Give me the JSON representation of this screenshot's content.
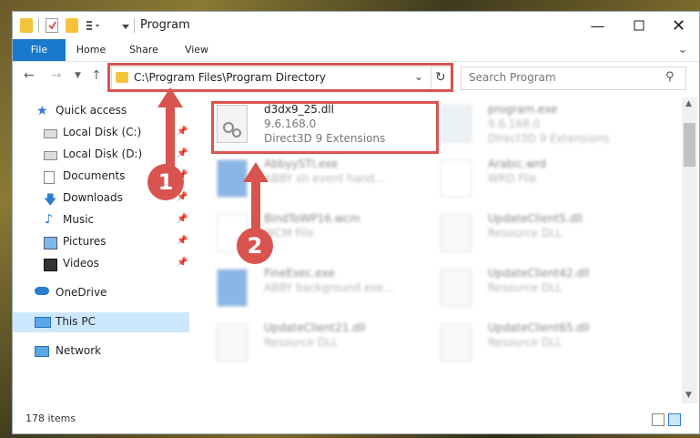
{
  "window": {
    "title": "Program"
  },
  "ribbon": {
    "tabs": [
      "File",
      "Home",
      "Share",
      "View"
    ]
  },
  "address": {
    "path": "C:\\Program Files\\Program Directory"
  },
  "search": {
    "placeholder": "Search Program"
  },
  "sidebar": {
    "items": [
      {
        "label": "Quick access",
        "icon": "star-icon",
        "pinned": false
      },
      {
        "label": "Local Disk (C:)",
        "icon": "drive-icon",
        "pinned": true
      },
      {
        "label": "Local Disk (D:)",
        "icon": "drive-icon",
        "pinned": true
      },
      {
        "label": "Documents",
        "icon": "documents-icon",
        "pinned": true
      },
      {
        "label": "Downloads",
        "icon": "download-icon",
        "pinned": true
      },
      {
        "label": "Music",
        "icon": "music-icon",
        "pinned": true
      },
      {
        "label": "Pictures",
        "icon": "pictures-icon",
        "pinned": true
      },
      {
        "label": "Videos",
        "icon": "videos-icon",
        "pinned": true
      },
      {
        "label": "OneDrive",
        "icon": "cloud-icon",
        "pinned": false
      },
      {
        "label": "This PC",
        "icon": "computer-icon",
        "pinned": false,
        "selected": true
      },
      {
        "label": "Network",
        "icon": "network-icon",
        "pinned": false
      }
    ]
  },
  "files": [
    {
      "name": "d3dx9_25.dll",
      "line2": "9.6.168.0",
      "line3": "Direct3D 9 Extensions",
      "highlight": true
    },
    {
      "name": "program.exe",
      "line2": "9.6.168.0",
      "line3": "Direct3D 9 Extensions"
    },
    {
      "name": "AbbyySTI.exe",
      "line2": "ABBY sti event hand...",
      "line3": ""
    },
    {
      "name": "Arabic.wrd",
      "line2": "WRD File",
      "line3": ""
    },
    {
      "name": "BindToWP16.wcm",
      "line2": "WCM File",
      "line3": ""
    },
    {
      "name": "UpdateClient5.dll",
      "line2": "Resource DLL",
      "line3": ""
    },
    {
      "name": "FineExec.exe",
      "line2": "ABBY background exe...",
      "line3": ""
    },
    {
      "name": "UpdateClient42.dll",
      "line2": "Resource DLL",
      "line3": ""
    },
    {
      "name": "UpdateClient21.dll",
      "line2": "Resource DLL",
      "line3": ""
    },
    {
      "name": "UpdateClient65.dll",
      "line2": "Resource DLL",
      "line3": ""
    }
  ],
  "status": {
    "count": "178 items"
  },
  "markers": {
    "one": "1",
    "two": "2"
  },
  "colors": {
    "accent": "#1979ca",
    "highlight": "#d9534f",
    "selected": "#cce8ff"
  }
}
